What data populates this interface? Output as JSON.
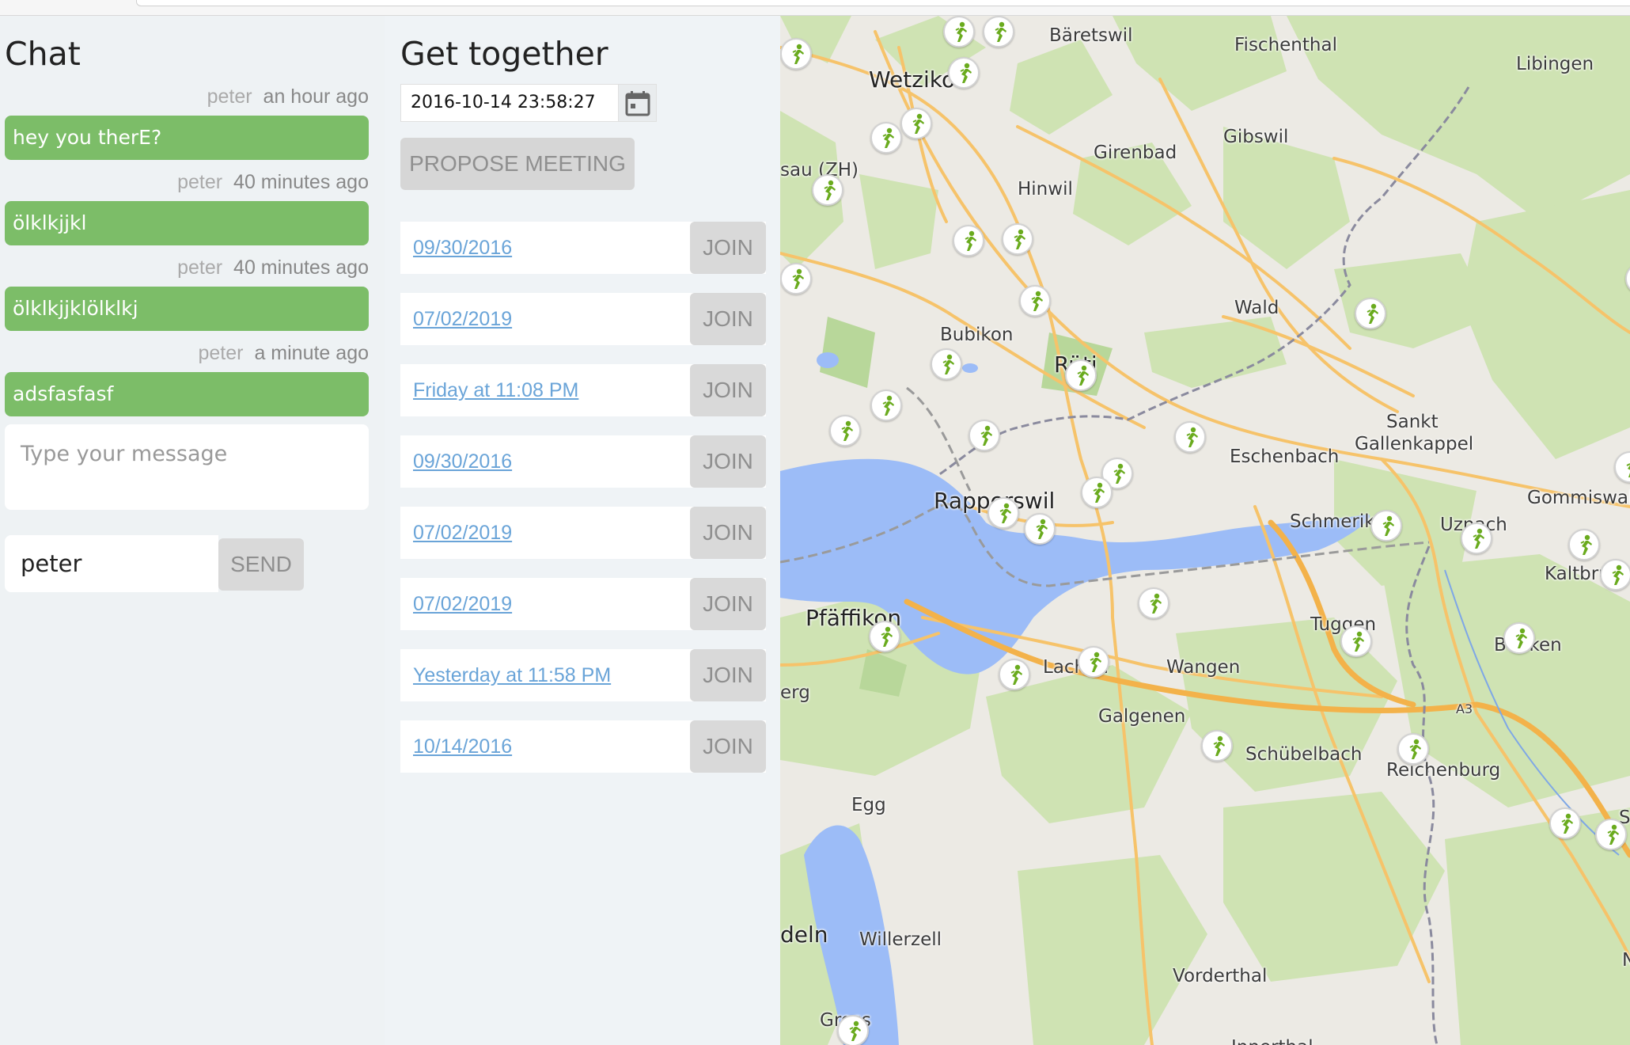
{
  "chat": {
    "title": "Chat",
    "messages": [
      {
        "author": "peter",
        "time": "an hour ago",
        "text": "hey you therE?"
      },
      {
        "author": "peter",
        "time": "40 minutes ago",
        "text": "ölklkjjkl"
      },
      {
        "author": "peter",
        "time": "40 minutes ago",
        "text": "ölklkjjklölklkj"
      },
      {
        "author": "peter",
        "time": "a minute ago",
        "text": "adsfasfasf"
      }
    ],
    "message_placeholder": "Type your message",
    "name_value": "peter",
    "send_label": "SEND"
  },
  "together": {
    "title": "Get together",
    "date_value": "2016-10-14 23:58:27",
    "calendar_icon": "calendar-icon",
    "propose_label": "PROPOSE MEETING",
    "join_label": "JOIN",
    "meetings": [
      {
        "date": "09/30/2016"
      },
      {
        "date": "07/02/2019"
      },
      {
        "date": "Friday at 11:08 PM"
      },
      {
        "date": "09/30/2016"
      },
      {
        "date": "07/02/2019"
      },
      {
        "date": "07/02/2019"
      },
      {
        "date": "Yesterday at 11:58 PM"
      },
      {
        "date": "10/14/2016"
      }
    ]
  },
  "map": {
    "places": [
      "Bäretswil",
      "Fischenthal",
      "Libingen",
      "Wetzikon",
      "Girenbad",
      "Gibswil",
      "sau (ZH)",
      "Hinwil",
      "Wald",
      "Bubikon",
      "Rüti",
      "Sankt",
      "Gallenkappel",
      "Eschenbach",
      "Gommiswal",
      "Rapperswil",
      "Schmerikon",
      "Uznach",
      "Kaltbrunn",
      "Pfäffikon",
      "Tuggen",
      "Benken",
      "Lachen",
      "Wangen",
      "erg",
      "A3",
      "Galgenen",
      "Schübelbach",
      "Reichenburg",
      "Egg",
      "deln",
      "Willerzell",
      "Vorderthal",
      "Gross",
      "Innerthal",
      "S",
      "N"
    ],
    "marker_icon": "running-person-icon",
    "colors": {
      "water": "#9cbcf7",
      "road": "#f6c36a",
      "forest": "#cfe3b3",
      "marker": "#6aab1e",
      "border": "#8a8a9e"
    }
  }
}
